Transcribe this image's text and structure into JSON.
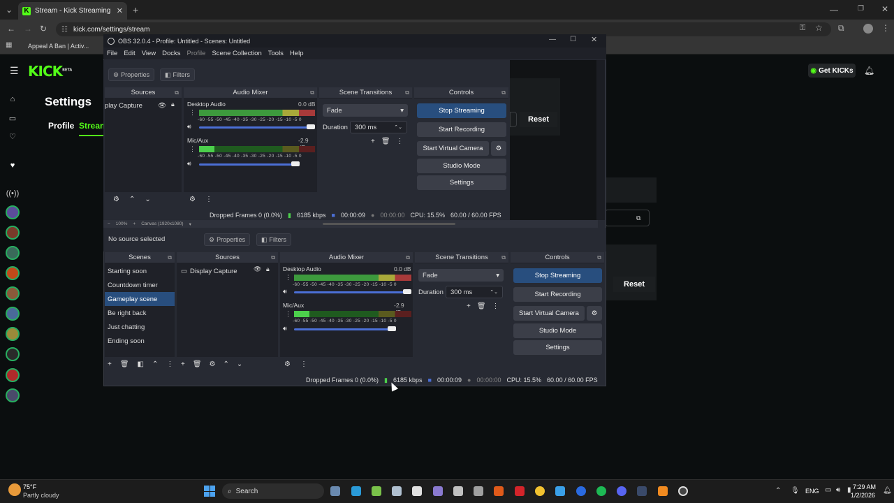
{
  "browser": {
    "tab_title": "Stream - Kick Streaming",
    "url": "kick.com/settings/stream",
    "bookmark": "Appeal A Ban | Activ..."
  },
  "kick": {
    "logo": "KICK",
    "beta": "BETA",
    "get_kicks": "Get KICKs",
    "settings_title": "Settings",
    "tab_profile": "Profile",
    "tab_stream": "Stream",
    "reset_1": "Reset",
    "reset_2": "Reset"
  },
  "obs": {
    "title": "OBS 32.0.4 - Profile: Untitled - Scenes: Untitled",
    "menu": [
      "File",
      "Edit",
      "View",
      "Docks",
      "Profile",
      "Scene Collection",
      "Tools",
      "Help"
    ],
    "properties": "Properties",
    "filters": "Filters",
    "no_source": "No source selected",
    "zoom": "100%",
    "canvas": "Canvas (1920x1080)",
    "docks": {
      "scenes": "Scenes",
      "sources": "Sources",
      "audio_mixer": "Audio Mixer",
      "scene_transitions": "Scene Transitions",
      "controls": "Controls"
    },
    "scenes": [
      "Starting soon",
      "Countdown timer",
      "Gameplay scene",
      "Be right back",
      "Just chatting",
      "Ending soon"
    ],
    "selected_scene": "Gameplay scene",
    "source_item": "Display Capture",
    "source_item_cut": "play Capture",
    "audio": [
      {
        "name": "Desktop Audio",
        "db": "0.0 dB",
        "level": 0.0,
        "volume": 1.0
      },
      {
        "name": "Mic/Aux",
        "db": "-2.9 dB",
        "level": 0.15,
        "volume": 0.85
      }
    ],
    "meter_ticks": "-60 -55 -50 -45 -40 -35 -30 -25 -20 -15 -10 -5 0",
    "transition": "Fade",
    "duration_label": "Duration",
    "duration": "300 ms",
    "controls": {
      "stop_streaming": "Stop Streaming",
      "start_recording": "Start Recording",
      "start_virtual_camera": "Start Virtual Camera",
      "studio_mode": "Studio Mode",
      "settings": "Settings"
    },
    "status": {
      "dropped": "Dropped Frames 0 (0.0%)",
      "kbps": "6185 kbps",
      "stream_time": "00:00:09",
      "rec_time": "00:00:00",
      "cpu": "CPU: 15.5%",
      "fps": "60.00 / 60.00 FPS"
    }
  },
  "taskbar": {
    "temp": "75°F",
    "weather": "Partly cloudy",
    "search": "Search",
    "lang": "ENG",
    "time": "7:29 AM",
    "date": "1/2/2026"
  },
  "colors": {
    "kick_green": "#53fc18",
    "obs_bg": "#272a33",
    "obs_highlight": "#284e7e"
  }
}
